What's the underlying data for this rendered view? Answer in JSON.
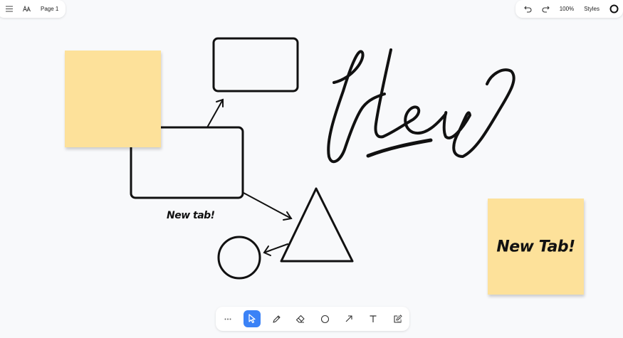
{
  "top_bar": {
    "page_label": "Page 1",
    "zoom_label": "100%",
    "styles_label": "Styles"
  },
  "canvas": {
    "text_shapes": [
      {
        "text": "New tab!"
      }
    ],
    "sticky_notes": [
      {
        "text": ""
      },
      {
        "text": "New Tab!"
      }
    ],
    "handwriting": "Hey"
  },
  "colors": {
    "sticky": "#fde19a",
    "active_tool": "#3b82f6",
    "stroke": "#111111"
  },
  "toolbar": {
    "tools": [
      "more",
      "select",
      "draw",
      "eraser",
      "ellipse",
      "arrow",
      "text",
      "edit"
    ],
    "active_tool": "select"
  }
}
